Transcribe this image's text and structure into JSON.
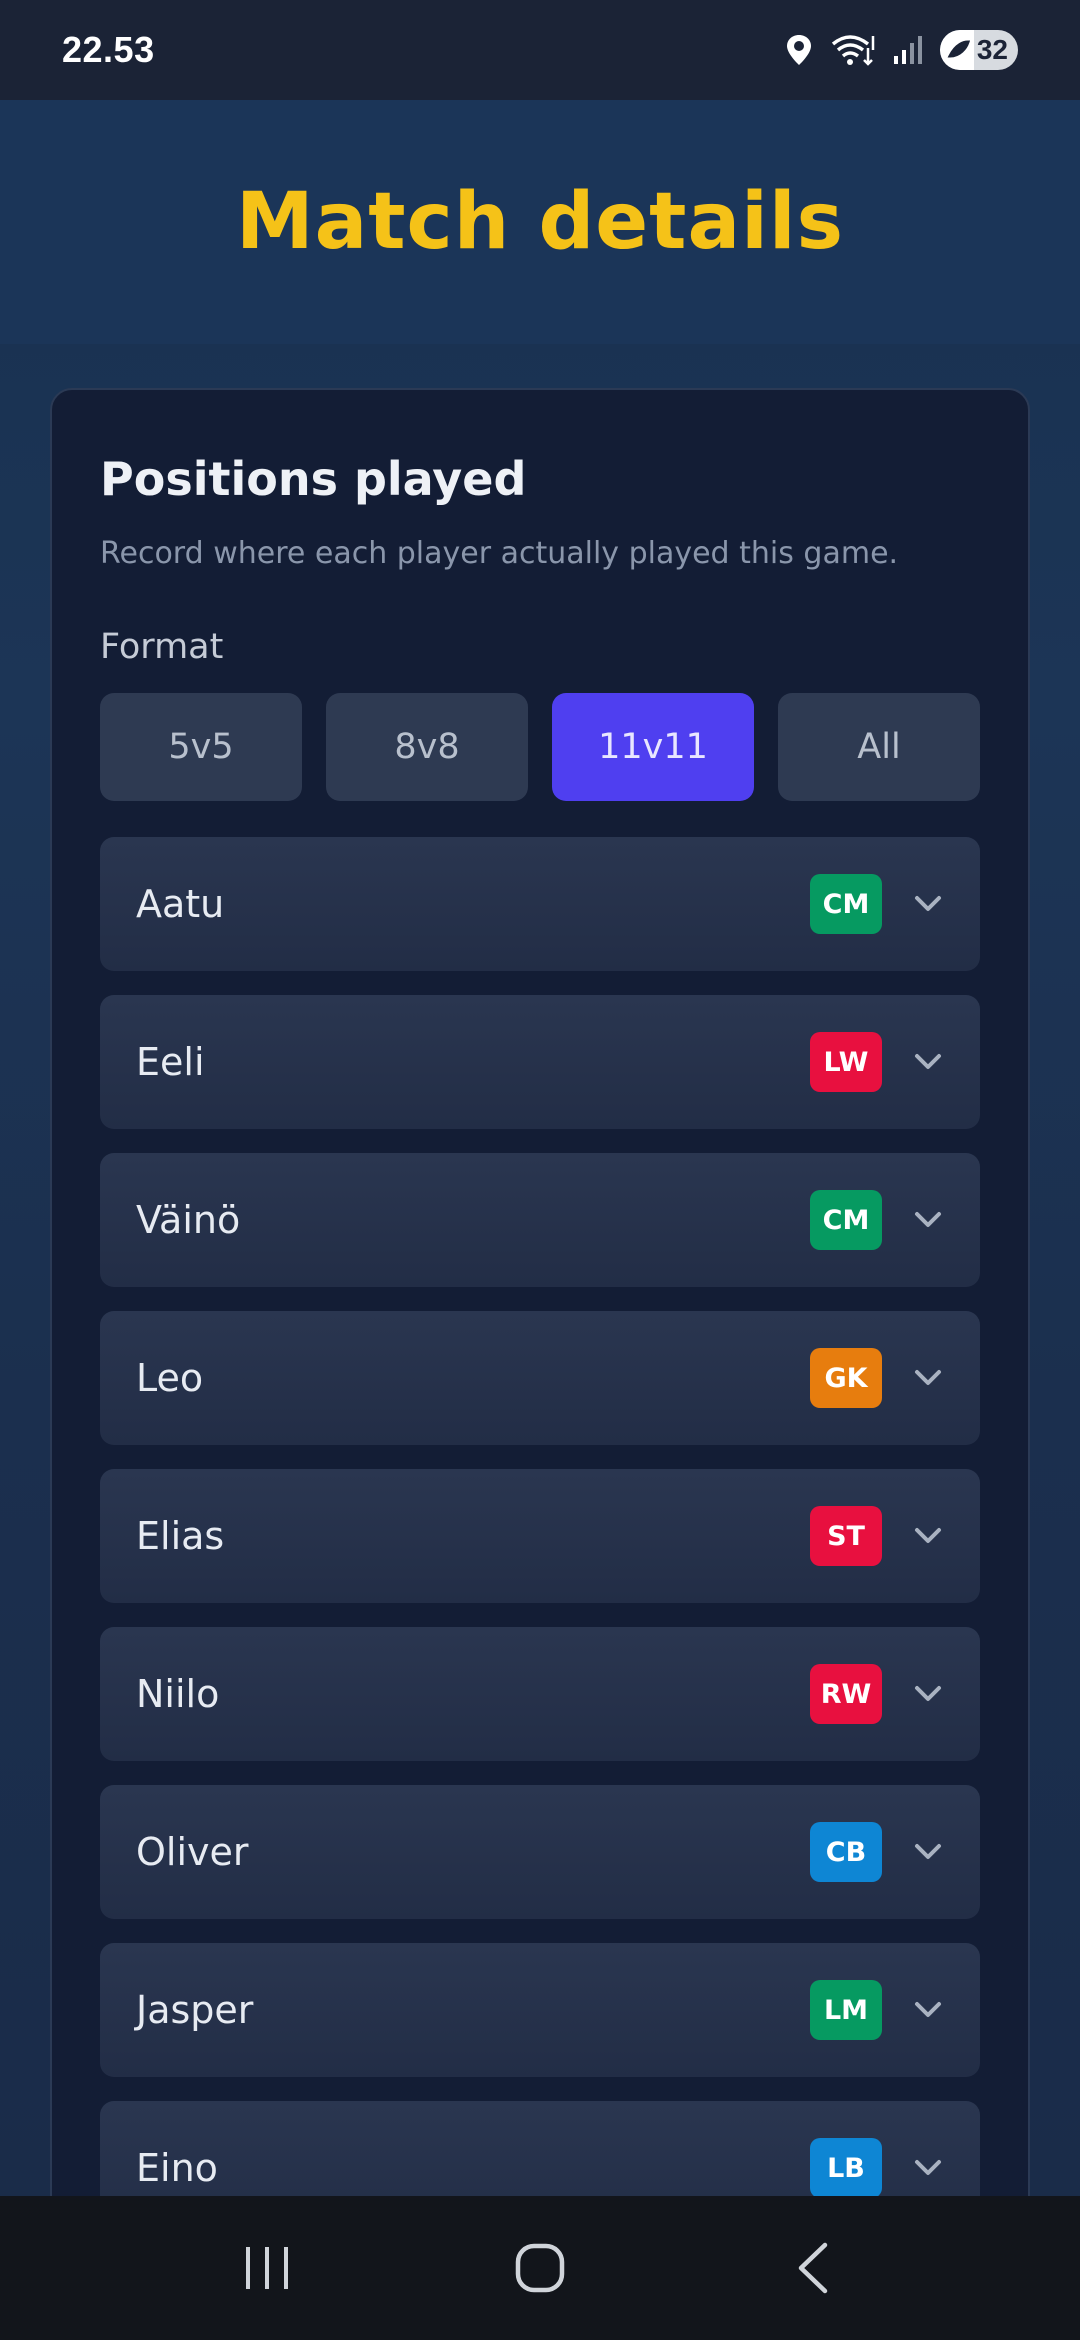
{
  "status_bar": {
    "time": "22.53",
    "battery": "32",
    "icons": [
      "location-icon",
      "wifi-icon",
      "signal-icon",
      "battery-icon"
    ]
  },
  "header": {
    "title": "Match details"
  },
  "card": {
    "title": "Positions played",
    "subtitle": "Record where each player actually played this game.",
    "format_label": "Format",
    "formats": [
      {
        "label": "5v5",
        "active": false
      },
      {
        "label": "8v8",
        "active": false
      },
      {
        "label": "11v11",
        "active": true
      },
      {
        "label": "All",
        "active": false
      }
    ],
    "players": [
      {
        "name": "Aatu",
        "position": "CM",
        "color": "#069a61"
      },
      {
        "name": "Eeli",
        "position": "LW",
        "color": "#e8103f"
      },
      {
        "name": "Väinö",
        "position": "CM",
        "color": "#069a61"
      },
      {
        "name": "Leo",
        "position": "GK",
        "color": "#e77d0e"
      },
      {
        "name": "Elias",
        "position": "ST",
        "color": "#e8103f"
      },
      {
        "name": "Niilo",
        "position": "RW",
        "color": "#e8103f"
      },
      {
        "name": "Oliver",
        "position": "CB",
        "color": "#0e86d4"
      },
      {
        "name": "Jasper",
        "position": "LM",
        "color": "#069a61"
      },
      {
        "name": "Eino",
        "position": "LB",
        "color": "#0e86d4"
      }
    ]
  },
  "colors": {
    "accent_title": "#f5c218",
    "active_format": "#4f3ff0",
    "card_bg": "#131d35"
  },
  "nav_bar": {
    "buttons": [
      "recent-apps-icon",
      "home-icon",
      "back-icon"
    ]
  }
}
